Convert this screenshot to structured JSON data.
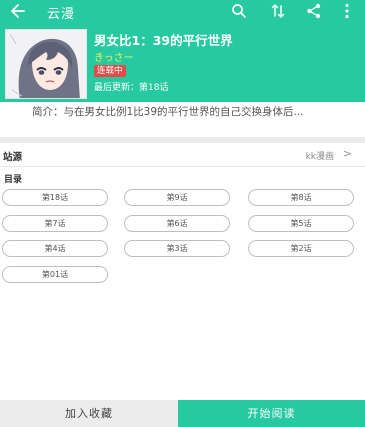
{
  "topbar": {
    "title": "云漫",
    "icons": [
      "back-arrow-icon",
      "search-icon",
      "sort-icon",
      "share-icon",
      "more-vertical-icon"
    ]
  },
  "comic": {
    "title": "男女比1：39的平行世界",
    "author": "きっさー",
    "status": "连载中",
    "last_update_label": "最后更新：",
    "last_update_value": "第18话",
    "intro_label": "简介：",
    "intro_text": "与在男女比例1比39的平行世界的自己交换身体后..."
  },
  "source": {
    "label": "站源",
    "value": "kk漫画",
    "chevron": ">"
  },
  "catalog": {
    "label": "目录",
    "chapters": [
      "第18话",
      "第9话",
      "第8话",
      "第7话",
      "第6话",
      "第5话",
      "第4话",
      "第3话",
      "第2话",
      "第01话"
    ]
  },
  "actions": {
    "favorite": "加入收藏",
    "read": "开始阅读"
  },
  "colors": {
    "accent": "#27c9a0",
    "status_badge": "#e34a4a",
    "author": "#e8f25a"
  }
}
